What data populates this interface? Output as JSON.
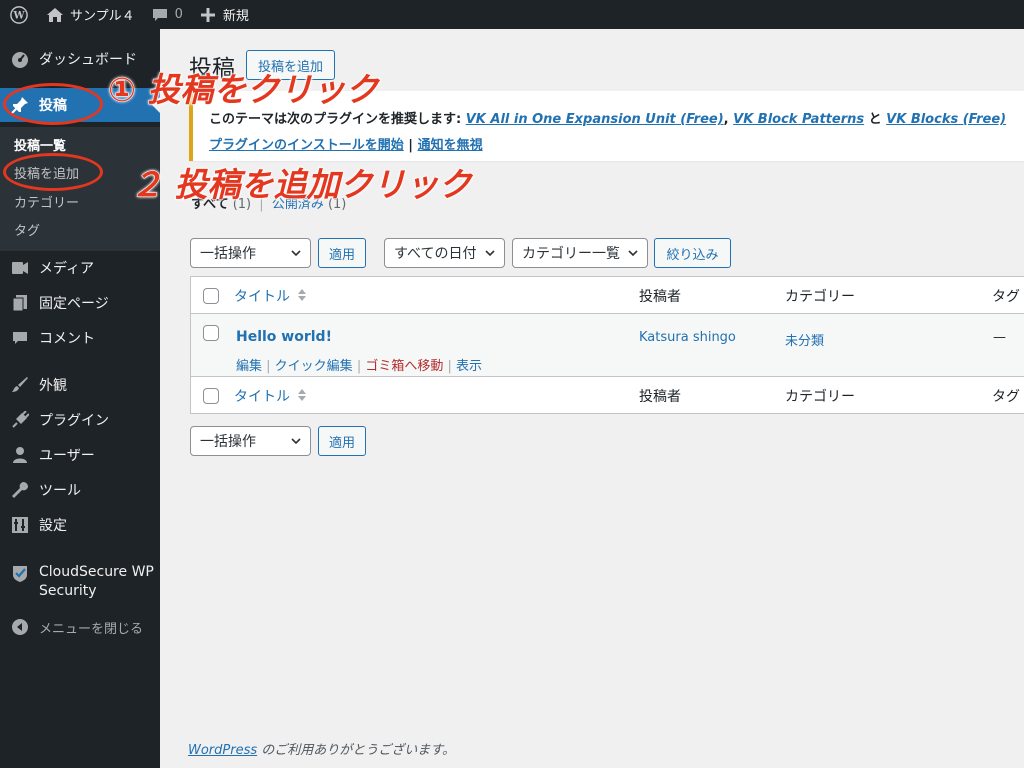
{
  "adminbar": {
    "wp_logo": "wordpress-logo-icon",
    "site_name": "サンプル４",
    "comments_count": "0",
    "new_label": "新規"
  },
  "sidebar": {
    "dashboard": "ダッシュボード",
    "posts": "投稿",
    "submenu": [
      "投稿一覧",
      "投稿を追加",
      "カテゴリー",
      "タグ"
    ],
    "media": "メディア",
    "pages": "固定ページ",
    "comments": "コメント",
    "appearance": "外観",
    "plugins": "プラグイン",
    "users": "ユーザー",
    "tools": "ツール",
    "settings": "設定",
    "cloudsecure_1": "CloudSecure WP",
    "cloudsecure_2": "Security",
    "collapse": "メニューを閉じる"
  },
  "main": {
    "title": "投稿",
    "add_new": "投稿を追加",
    "notice": {
      "prefix": "このテーマは次のプラグインを推奨します: ",
      "plugin1": "VK All in One Expansion Unit (Free)",
      "sep1": ", ",
      "plugin2": "VK Block Patterns",
      "sep2": " と ",
      "plugin3": "VK Blocks (Free)",
      "install_link": "プラグインのインストールを開始",
      "sep3": " | ",
      "dismiss_link": "通知を無視"
    },
    "filters": {
      "all": "すべて",
      "all_count": "(1)",
      "sep": "|",
      "published": "公開済み",
      "published_count": "(1)"
    },
    "bulk_action": "一括操作",
    "apply": "適用",
    "all_dates": "すべての日付",
    "all_categories": "カテゴリー一覧",
    "filter_button": "絞り込み",
    "columns": {
      "title": "タイトル",
      "author": "投稿者",
      "categories": "カテゴリー",
      "tags": "タグ"
    },
    "rows": [
      {
        "title": "Hello world!",
        "author": "Katsura shingo",
        "category": "未分類",
        "tags": "—",
        "actions": [
          "編集",
          "クイック編集",
          "ゴミ箱へ移動",
          "表示"
        ]
      }
    ],
    "footer_link": "WordPress",
    "footer_text": " のご利用ありがとうございます。"
  },
  "annotations": {
    "step1": "① 投稿をクリック",
    "step2": "２ 投稿を追加クリック",
    "color": "#e4371f"
  }
}
